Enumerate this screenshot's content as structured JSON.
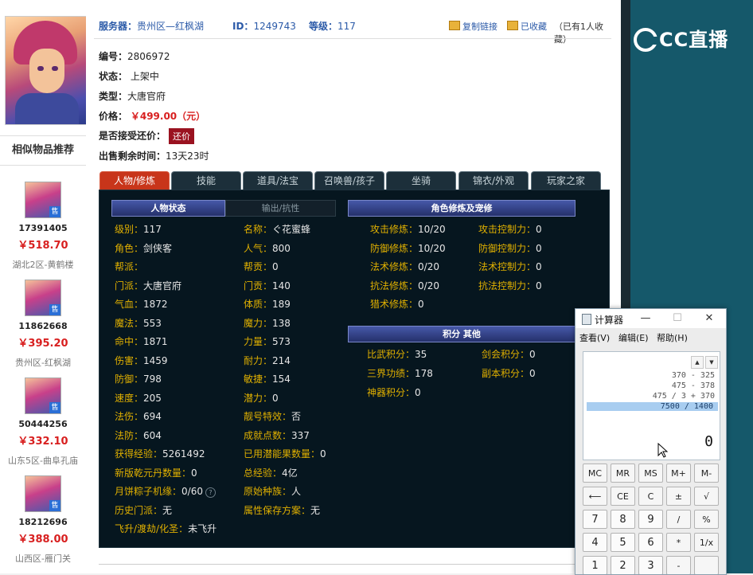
{
  "header": {
    "server_label": "服务器：",
    "server_value": "贵州区—红枫湖",
    "id_label": "ID：",
    "id_value": "1249743",
    "level_label": "等级：",
    "level_value": "117",
    "copy_link": "复制链接",
    "favorited": "已收藏",
    "fav_count": "（已有1人收藏）"
  },
  "info": {
    "number_label": "编号：",
    "number_value": "2806972",
    "status_label": "状态：",
    "status_value": "上架中",
    "type_label": "类型：",
    "type_value": "大唐官府",
    "price_label": "价格：",
    "price_value": "￥499.00（元）",
    "counter_label": "是否接受还价：",
    "counter_button": "还价",
    "remain_label": "出售剩余时间：",
    "remain_value": "13天23时"
  },
  "sidebar": {
    "title": "相似物品推荐",
    "badge": "售",
    "items": [
      {
        "id": "17391405",
        "price": "￥518.70",
        "server": "湖北2区-黄鹤楼"
      },
      {
        "id": "11862668",
        "price": "￥395.20",
        "server": "贵州区-红枫湖"
      },
      {
        "id": "50444256",
        "price": "￥332.10",
        "server": "山东5区-曲阜孔庙"
      },
      {
        "id": "18212696",
        "price": "￥388.00",
        "server": "山西区-雁门关"
      }
    ]
  },
  "tabs": [
    "人物/修炼",
    "技能",
    "道具/法宝",
    "召唤兽/孩子",
    "坐骑",
    "锦衣/外观",
    "玩家之家"
  ],
  "panel": {
    "sec_status": "人物状态",
    "sec_resist": "输出/抗性",
    "sec_cultivation": "角色修炼及宠修",
    "sec_points": "积分 其他",
    "col1": [
      {
        "label": "级别：",
        "value": "117"
      },
      {
        "label": "角色：",
        "value": "剑侠客"
      },
      {
        "label": "帮派：",
        "value": ""
      },
      {
        "label": "门派：",
        "value": "大唐官府"
      },
      {
        "label": "气血：",
        "value": "1872"
      },
      {
        "label": "魔法：",
        "value": "553"
      },
      {
        "label": "命中：",
        "value": "1871"
      },
      {
        "label": "伤害：",
        "value": "1459"
      },
      {
        "label": "防御：",
        "value": "798"
      },
      {
        "label": "速度：",
        "value": "205"
      },
      {
        "label": "法伤：",
        "value": "694"
      },
      {
        "label": "法防：",
        "value": "604"
      },
      {
        "label": "获得经验：",
        "value": "5261492"
      },
      {
        "label": "新版乾元丹数量：",
        "value": "0"
      },
      {
        "label": "月饼粽子机缘：",
        "value": "0/60"
      },
      {
        "label": "历史门派：",
        "value": "无"
      },
      {
        "label": "飞升/渡劫/化圣：",
        "value": "未飞升"
      }
    ],
    "col2": [
      {
        "label": "名称：",
        "value": "ぐ花蜜蜂"
      },
      {
        "label": "人气：",
        "value": "800"
      },
      {
        "label": "帮贡：",
        "value": "0"
      },
      {
        "label": "门贡：",
        "value": "140"
      },
      {
        "label": "体质：",
        "value": "189"
      },
      {
        "label": "魔力：",
        "value": "138"
      },
      {
        "label": "力量：",
        "value": "573"
      },
      {
        "label": "耐力：",
        "value": "214"
      },
      {
        "label": "敏捷：",
        "value": "154"
      },
      {
        "label": "潜力：",
        "value": "0"
      },
      {
        "label": "靓号特效：",
        "value": "否"
      },
      {
        "label": "成就点数：",
        "value": "337"
      },
      {
        "label": "已用潜能果数量：",
        "value": "0"
      },
      {
        "label": "总经验：",
        "value": "4亿"
      },
      {
        "label": "原始种族：",
        "value": "人"
      },
      {
        "label": "属性保存方案：",
        "value": "无"
      }
    ],
    "cult1": [
      {
        "label": "攻击修炼：",
        "value": "10/20"
      },
      {
        "label": "防御修炼：",
        "value": "10/20"
      },
      {
        "label": "法术修炼：",
        "value": "0/20"
      },
      {
        "label": "抗法修炼：",
        "value": "0/20"
      },
      {
        "label": "猎术修炼：",
        "value": "0"
      }
    ],
    "cult2": [
      {
        "label": "攻击控制力：",
        "value": "0"
      },
      {
        "label": "防御控制力：",
        "value": "0"
      },
      {
        "label": "法术控制力：",
        "value": "0"
      },
      {
        "label": "抗法控制力：",
        "value": "0"
      }
    ],
    "points1": [
      {
        "label": "比武积分：",
        "value": "35"
      },
      {
        "label": "三界功绩：",
        "value": "178"
      },
      {
        "label": "神器积分：",
        "value": "0"
      }
    ],
    "points2": [
      {
        "label": "剑会积分：",
        "value": "0"
      },
      {
        "label": "副本积分：",
        "value": "0"
      }
    ]
  },
  "brand": {
    "logo_text": "CC直播"
  },
  "calculator": {
    "title": "计算器",
    "menu": [
      "查看(V)",
      "编辑(E)",
      "帮助(H)"
    ],
    "history": [
      "370 - 325",
      "475 - 378",
      "475 / 3 + 370",
      "7500 / 1400"
    ],
    "value": "0",
    "keys": [
      [
        "MC",
        "MR",
        "MS",
        "M+",
        "M-"
      ],
      [
        "⟵",
        "CE",
        "C",
        "±",
        "√"
      ],
      [
        "7",
        "8",
        "9",
        "/",
        "%"
      ],
      [
        "4",
        "5",
        "6",
        "*",
        "1/x"
      ],
      [
        "1",
        "2",
        "3",
        "-",
        ""
      ]
    ]
  }
}
